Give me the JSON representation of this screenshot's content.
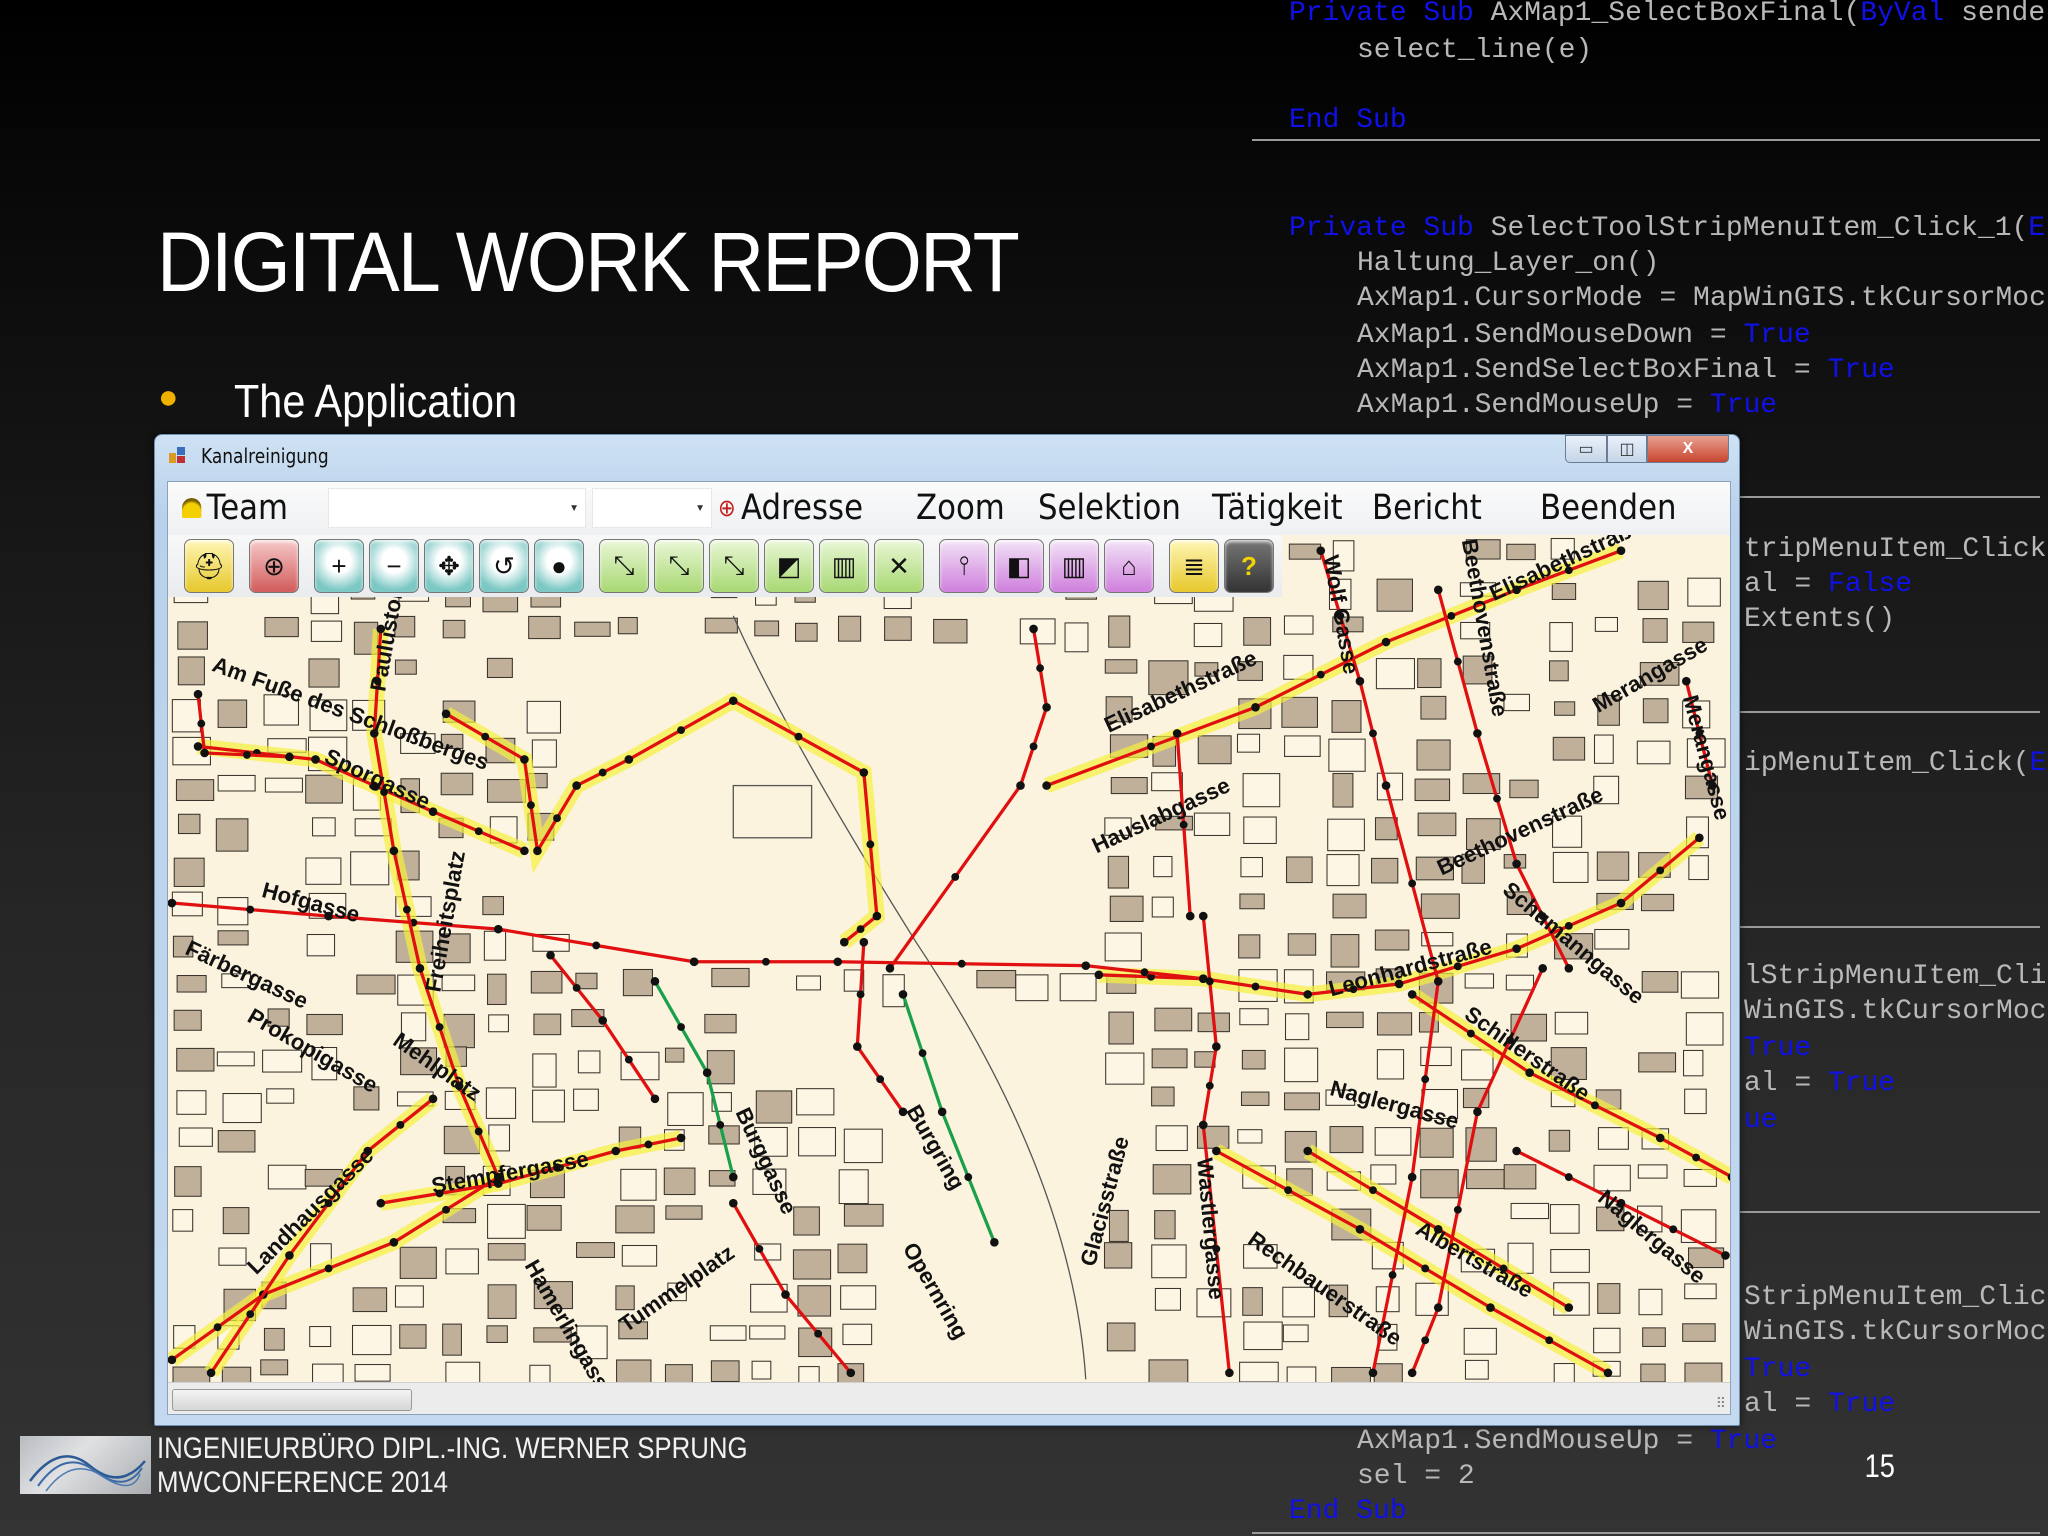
{
  "slide": {
    "title": "DIGITAL WORK REPORT",
    "bullet": "The Application",
    "footer_line1": "INGENIEURBÜRO DIPL.-ING. WERNER SPRUNG",
    "footer_line2": "MWCONFERENCE 2014",
    "page_number": "15",
    "bullet_color": "#f0b000"
  },
  "code": [
    [
      {
        "t": "Private Sub",
        "kw": true
      },
      {
        "t": " AxMap1_SelectBoxFinal("
      },
      {
        "t": "ByVal",
        "kw": true
      },
      {
        "t": " sende"
      }
    ],
    [
      {
        "t": "select_line(e)"
      }
    ],
    [
      {
        "t": "End Sub",
        "kw": true
      }
    ],
    [
      {
        "t": "Private Sub",
        "kw": true
      },
      {
        "t": " SelectToolStripMenuItem_Click_1("
      },
      {
        "t": "E",
        "kw": true
      }
    ],
    [
      {
        "t": "Haltung_Layer_on()"
      }
    ],
    [
      {
        "t": "AxMap1.CursorMode = MapWinGIS.tkCursorMoc"
      }
    ],
    [
      {
        "t": "AxMap1.SendMouseDown = "
      },
      {
        "t": "True",
        "kw": true
      }
    ],
    [
      {
        "t": "AxMap1.SendSelectBoxFinal = "
      },
      {
        "t": "True",
        "kw": true
      }
    ],
    [
      {
        "t": "AxMap1.SendMouseUp = "
      },
      {
        "t": "True",
        "kw": true
      }
    ],
    [
      {
        "t": "tripMenuItem_Click"
      }
    ],
    [
      {
        "t": "al = "
      },
      {
        "t": "False",
        "kw": true
      }
    ],
    [
      {
        "t": "Extents()"
      }
    ],
    [
      {
        "t": "ipMenuItem_Click("
      },
      {
        "t": "E",
        "kw": true
      }
    ],
    [
      {
        "t": "lStripMenuItem_Cli"
      }
    ],
    [
      {
        "t": "WinGIS.tkCursorMoc"
      }
    ],
    [
      {
        "t": "True",
        "kw": true
      }
    ],
    [
      {
        "t": "al = "
      },
      {
        "t": "True",
        "kw": true
      }
    ],
    [
      {
        "t": "ue",
        "kw": true
      }
    ],
    [
      {
        "t": "StripMenuItem_Clic"
      }
    ],
    [
      {
        "t": "WinGIS.tkCursorMoc"
      }
    ],
    [
      {
        "t": "True",
        "kw": true
      }
    ],
    [
      {
        "t": "al = "
      },
      {
        "t": "True",
        "kw": true
      }
    ],
    [
      {
        "t": "AxMap1.SendMouseUp = "
      },
      {
        "t": "True",
        "kw": true
      }
    ],
    [
      {
        "t": "sel = 2"
      }
    ],
    [
      {
        "t": "End Sub",
        "kw": true
      }
    ]
  ],
  "window": {
    "title": "Kanalreinigung",
    "minimize": "▭",
    "maximize": "◫",
    "close": "X"
  },
  "menu": {
    "team": "Team",
    "team_combo_value": "",
    "second_combo_value": "",
    "address": "Adresse",
    "zoom": "Zoom",
    "selection": "Selektion",
    "activity": "Tätigkeit",
    "report": "Bericht",
    "exit": "Beenden"
  },
  "toolbar": [
    {
      "icon": "helmet-icon",
      "glyph": "⛑",
      "color": "yellow"
    },
    {
      "icon": "crosshair-icon",
      "glyph": "⊕",
      "color": "red"
    },
    {
      "icon": "zoom-in-icon",
      "glyph": "+",
      "color": "teal"
    },
    {
      "icon": "zoom-out-icon",
      "glyph": "−",
      "color": "teal"
    },
    {
      "icon": "pan-icon",
      "glyph": "✥",
      "color": "teal"
    },
    {
      "icon": "zoom-previous-icon",
      "glyph": "↺",
      "color": "teal"
    },
    {
      "icon": "full-extent-icon",
      "glyph": "●",
      "color": "teal"
    },
    {
      "icon": "select-pipe-icon",
      "glyph": "⤡",
      "color": "green"
    },
    {
      "icon": "add-selection-icon",
      "glyph": "⤡",
      "color": "green"
    },
    {
      "icon": "remove-selection-icon",
      "glyph": "⤡",
      "color": "green"
    },
    {
      "icon": "select-box-icon",
      "glyph": "◩",
      "color": "green"
    },
    {
      "icon": "select-grid-icon",
      "glyph": "▥",
      "color": "green"
    },
    {
      "icon": "clear-selection-icon",
      "glyph": "✕",
      "color": "green"
    },
    {
      "icon": "manhole-icon",
      "glyph": "⫯",
      "color": "purple"
    },
    {
      "icon": "camera-icon",
      "glyph": "◧",
      "color": "purple"
    },
    {
      "icon": "grate-icon",
      "glyph": "▥",
      "color": "purple"
    },
    {
      "icon": "house-icon",
      "glyph": "⌂",
      "color": "purple"
    },
    {
      "icon": "report-icon",
      "glyph": "≣",
      "color": "yellow"
    },
    {
      "icon": "help-icon",
      "glyph": "?",
      "color": "dark"
    }
  ],
  "map": {
    "streets": [
      "Am Fuße des Schloßberges",
      "Paulustor",
      "Sporgasse",
      "Hofgasse",
      "Freiheitsplatz",
      "Färbergasse",
      "Prokopigasse",
      "Mehlplatz",
      "Stempfergasse",
      "Landhausgasse",
      "Burggasse",
      "Burgring",
      "Opernring",
      "Tummelplatz",
      "Hamerlingasse",
      "Glacisstraße",
      "Wastlergasse",
      "Rechbauerstraße",
      "Albertstraße",
      "Naglergasse",
      "Schillerstraße",
      "Leonhardstraße",
      "Schumanngasse",
      "Beethovenstraße",
      "Hauslabgasse",
      "Elisabethstraße",
      "Merangasse",
      "Elisabethstraße",
      "Merangasse",
      "Naglergasse",
      "Wolf Gasse",
      "Beethovenstraße"
    ],
    "colors": {
      "pipe": "#e01010",
      "highlight": "#f5ef3a",
      "cleaned": "#1aa04a",
      "building": "#c0b09a",
      "ground": "#fbf3de"
    }
  }
}
